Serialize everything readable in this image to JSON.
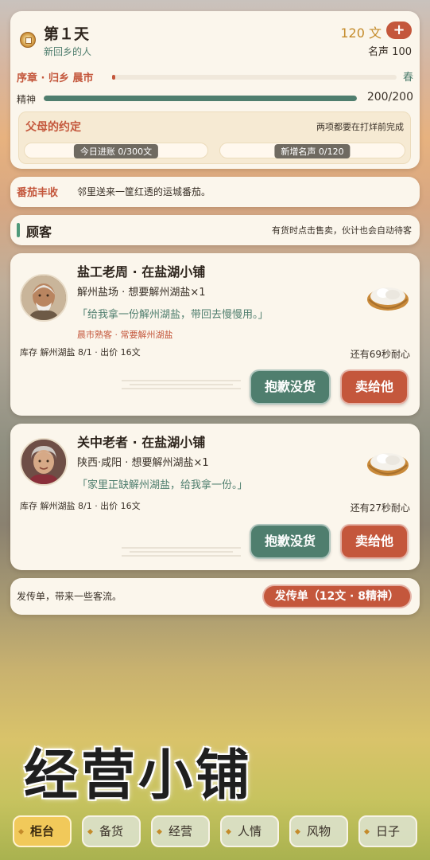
{
  "header": {
    "day": "第１天",
    "subtitle": "新回乡的人",
    "money": "120 文",
    "add_icon": "+",
    "fame": "名声 100",
    "chapter": "序章 · 归乡 晨市",
    "chapter_progress": 0.01,
    "season": "春",
    "stamina_label": "精神",
    "stamina_value": "200/200",
    "stamina_progress": 1.0
  },
  "promise": {
    "title": "父母的约定",
    "hint": "两项都要在打烊前完成",
    "goal_income": "今日进账 0/300文",
    "goal_income_progress": 0.0,
    "goal_fame": "新增名声 0/120",
    "goal_fame_progress": 0.0
  },
  "news": {
    "tag": "番茄丰收",
    "text": "邻里送来一筐红透的运城番茄。"
  },
  "customers_section": {
    "title": "顾客",
    "hint": "有货时点击售卖，伙计也会自动待客"
  },
  "customers": [
    {
      "name": "盐工老周 · 在盐湖小铺",
      "info": "解州盐场 · 想要解州湖盐×1",
      "quote": "「给我拿一份解州湖盐，带回去慢慢用。」",
      "tag": "晨市熟客 · 常要解州湖盐",
      "stock": "库存 解州湖盐 8/1 · 出价 16文",
      "time": "还有69秒耐心",
      "decline": "抱歉没货",
      "sell": "卖给他"
    },
    {
      "name": "关中老者 · 在盐湖小铺",
      "info": "陕西·咸阳 · 想要解州湖盐×1",
      "quote": "「家里正缺解州湖盐，给我拿一份。」",
      "tag": "",
      "stock": "库存 解州湖盐 8/1 · 出价 16文",
      "time": "还有27秒耐心",
      "decline": "抱歉没货",
      "sell": "卖给他"
    }
  ],
  "flyer": {
    "text": "发传单，带来一些客流。",
    "button": "发传单（12文 · 8精神）"
  },
  "title": "经营小铺",
  "tabs": [
    "柜台",
    "备货",
    "经营",
    "人情",
    "风物",
    "日子"
  ],
  "active_tab": "柜台",
  "colors": {
    "accent_red": "#c4573c",
    "accent_green": "#4f7e6e",
    "gold": "#c48b2a",
    "card_bg": "#fbf6ec",
    "active_tab": "#f1c95a"
  },
  "icons": {
    "coin": "coin-icon",
    "salt": "salt-basket-icon",
    "add": "plus-icon"
  }
}
